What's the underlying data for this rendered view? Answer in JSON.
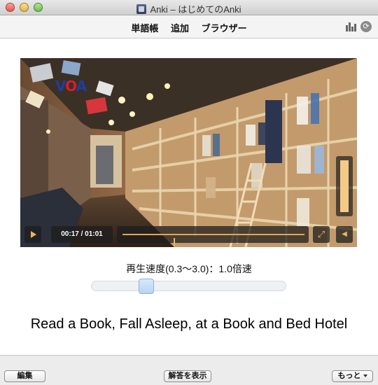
{
  "window": {
    "title": "Anki – はじめてのAnki"
  },
  "toolbar": {
    "decks_label": "単語帳",
    "add_label": "追加",
    "browse_label": "ブラウザー"
  },
  "video": {
    "logo_v": "V",
    "logo_o": "O",
    "logo_a": "A",
    "time_display": "00:17 / 01:01",
    "progress": 0.28,
    "volume": 1.0,
    "fullscreen_glyph": "⤢",
    "mute_glyph": "◀"
  },
  "speed": {
    "label": "再生速度(0.3〜3.0)：1.0倍速",
    "value": 1.0,
    "min": 0.3,
    "max": 3.0
  },
  "card": {
    "caption": "Read a Book, Fall Asleep, at a Book and Bed Hotel"
  },
  "bottom": {
    "edit_label": "編集",
    "show_answer_label": "解答を表示",
    "more_label": "もっと"
  },
  "colors": {
    "accent": "#f0b35a",
    "volume_fill": "#f5c986"
  }
}
